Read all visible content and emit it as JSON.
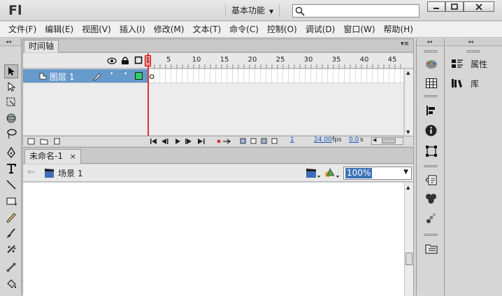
{
  "app": {
    "logo": "Fl",
    "workspace": "基本功能",
    "search_placeholder": ""
  },
  "window_controls": {
    "minimize": "−",
    "maximize": "□",
    "close": "×"
  },
  "menu": [
    "文件(F)",
    "编辑(E)",
    "视图(V)",
    "插入(I)",
    "修改(M)",
    "文本(T)",
    "命令(C)",
    "控制(O)",
    "调试(D)",
    "窗口(W)",
    "帮助(H)"
  ],
  "timeline": {
    "tab": "时间轴",
    "layer_name": "图层 1",
    "frame_numbers": [
      "1",
      "5",
      "10",
      "15",
      "20",
      "25",
      "30",
      "35",
      "40",
      "45"
    ],
    "current_frame": "1",
    "fps": "24.00",
    "fps_unit": "fps",
    "elapsed": "0.0",
    "elapsed_unit": "s"
  },
  "stage": {
    "tab": "未命名-1",
    "scene": "场景 1",
    "zoom": "100%"
  },
  "properties": [
    {
      "icon": "properties-icon",
      "label": "属性"
    },
    {
      "icon": "library-icon",
      "label": "库"
    }
  ],
  "colors": {
    "accent": "#6699cc",
    "playhead": "#dd3333",
    "layer_color": "#33cc66",
    "zoom_highlight": "#3d74b8"
  }
}
